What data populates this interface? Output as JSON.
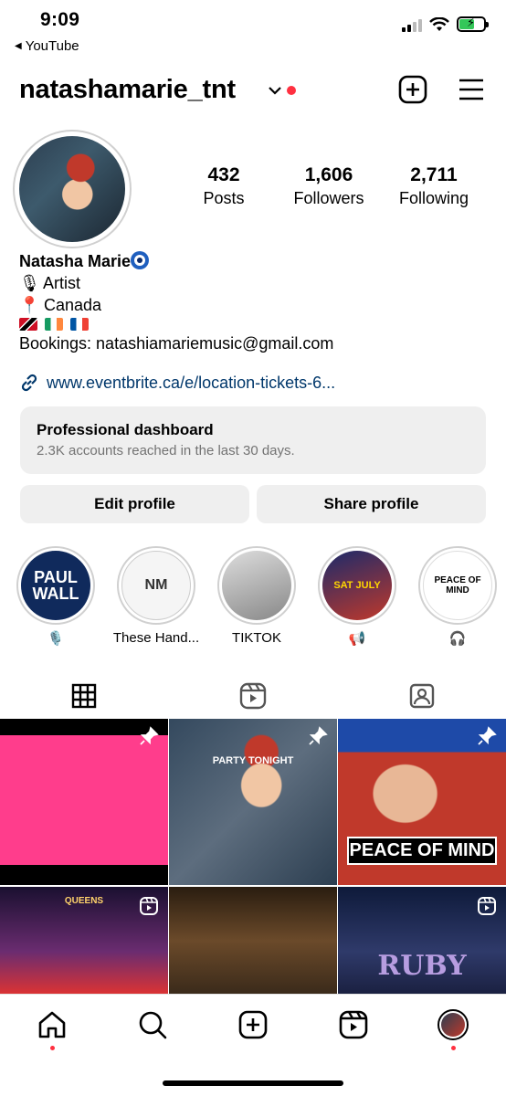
{
  "status_bar": {
    "time": "9:09",
    "back_app": "YouTube"
  },
  "header": {
    "username": "natashamarie_tnt"
  },
  "stats": [
    {
      "count": "432",
      "label": "Posts"
    },
    {
      "count": "1,606",
      "label": "Followers"
    },
    {
      "count": "2,711",
      "label": "Following"
    }
  ],
  "bio": {
    "name": "Natasha Marie",
    "line1": "Artist",
    "line2": "Canada",
    "bookings": "Bookings: natashiamariemusic@gmail.com",
    "link": "www.eventbrite.ca/e/location-tickets-6..."
  },
  "dashboard": {
    "title": "Professional dashboard",
    "subtitle": "2.3K accounts reached in the last 30 days."
  },
  "buttons": {
    "edit": "Edit profile",
    "share": "Share profile"
  },
  "highlights": [
    {
      "label": "🎙️",
      "art": "PAUL WALL"
    },
    {
      "label": "These Hand...",
      "art": "NM"
    },
    {
      "label": "TIKTOK",
      "art": ""
    },
    {
      "label": "📢",
      "art": "SAT JULY"
    },
    {
      "label": "🎧",
      "art": "PEACE OF MIND"
    }
  ],
  "posts": [
    {
      "text": ""
    },
    {
      "text": "PARTY TONIGHT"
    },
    {
      "text": "PEACE OF MIND"
    },
    {
      "text": "QUEENS"
    },
    {
      "text": ""
    },
    {
      "text": "RUBY"
    }
  ],
  "colors": {
    "accent_red": "#ff3040",
    "link": "#00376b",
    "muted": "#737373"
  }
}
